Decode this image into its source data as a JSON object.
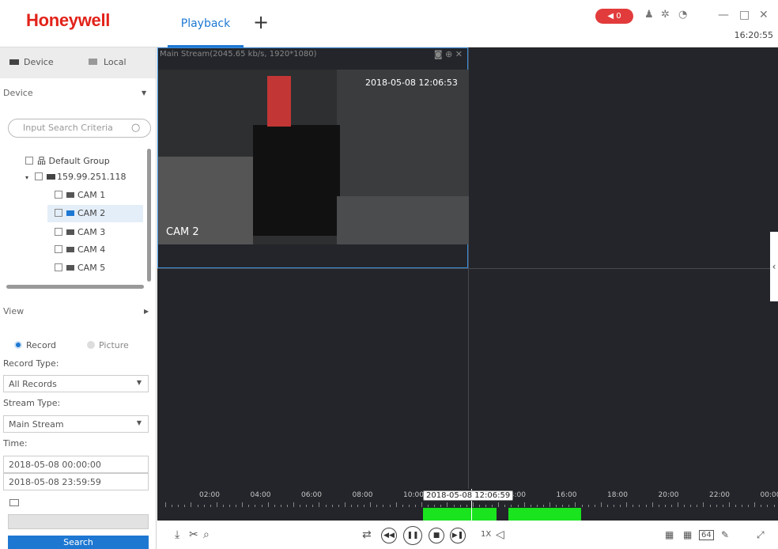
{
  "app": {
    "logo": "Honeywell",
    "tab": "Playback",
    "add_tab": "+",
    "alarm_count": "0",
    "clock": "16:20:55"
  },
  "window_controls": {
    "minimize": "—",
    "maximize": "□",
    "close": "✕"
  },
  "sidebar": {
    "tab_device": "Device",
    "tab_local": "Local",
    "device_section": "Device",
    "search_placeholder": "Input Search Criteria",
    "tree": {
      "group": "Default Group",
      "ip": "159.99.251.118",
      "cams": [
        "CAM 1",
        "CAM 2",
        "CAM 3",
        "CAM 4",
        "CAM 5"
      ]
    },
    "view_section": "View",
    "mode_record": "Record",
    "mode_picture": "Picture",
    "record_type_label": "Record Type:",
    "record_type_value": "All Records",
    "stream_type_label": "Stream Type:",
    "stream_type_value": "Main Stream",
    "time_label": "Time:",
    "time_start": "2018-05-08 00:00:00",
    "time_end": "2018-05-08 23:59:59",
    "search_button": "Search"
  },
  "video": {
    "stream_info": "Main Stream(2045.65 kb/s, 1920*1080)",
    "osd_time": "2018-05-08 12:06:53",
    "cam_label": "CAM 2"
  },
  "timeline": {
    "labels": [
      "02:00",
      "04:00",
      "06:00",
      "08:00",
      "10:00",
      "12:00",
      "14:00",
      "16:00",
      "18:00",
      "20:00",
      "22:00",
      "00:00"
    ],
    "cursor": "2018-05-08 12:06:59",
    "speed": "1X"
  },
  "controls": {
    "grid64": "64"
  }
}
